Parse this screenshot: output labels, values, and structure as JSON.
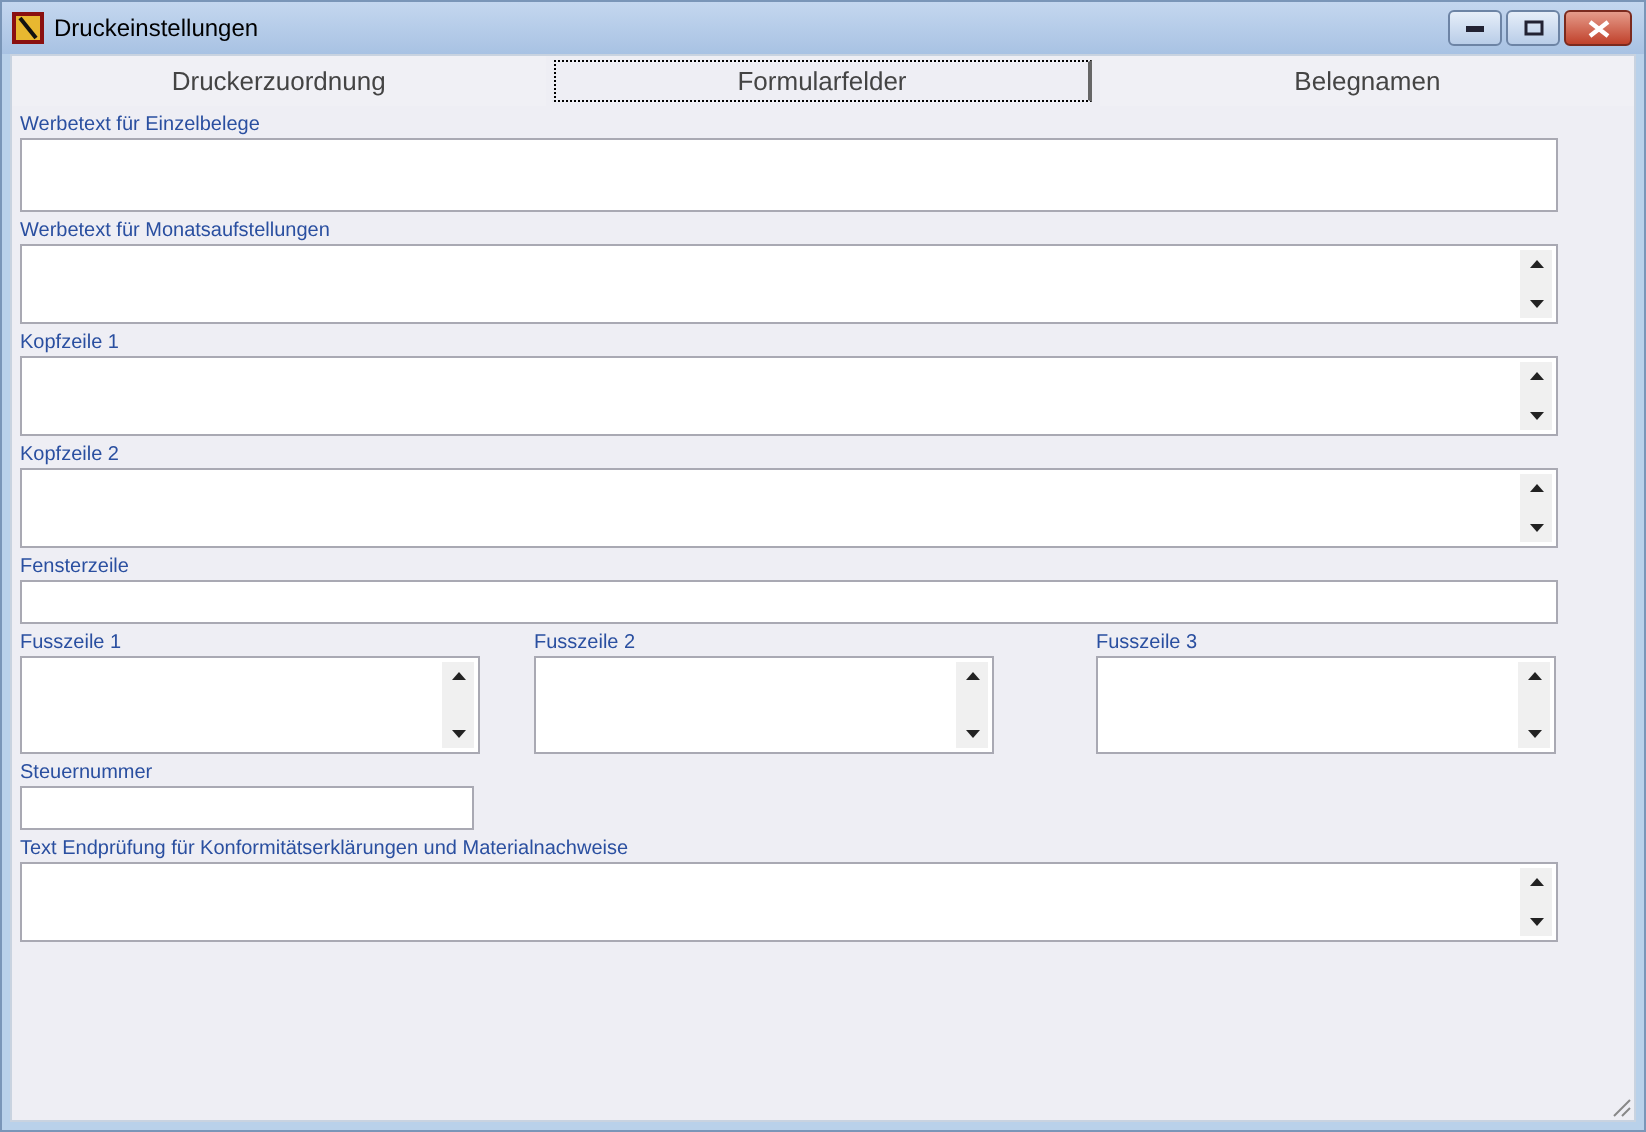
{
  "window": {
    "title": "Druckeinstellungen"
  },
  "tabs": [
    {
      "label": "Druckerzuordnung",
      "selected": false
    },
    {
      "label": "Formularfelder",
      "selected": true
    },
    {
      "label": "Belegnamen",
      "selected": false
    }
  ],
  "rows": [
    {
      "fields": [
        {
          "label": "Werbetext für Einzelbelege",
          "kind": "box"
        }
      ]
    },
    {
      "fields": [
        {
          "label": "Werbetext für Monatsaufstellungen",
          "kind": "memo"
        }
      ]
    },
    {
      "fields": [
        {
          "label": "Kopfzeile 1",
          "kind": "memo"
        }
      ]
    },
    {
      "fields": [
        {
          "label": "Kopfzeile 2",
          "kind": "memo"
        }
      ]
    },
    {
      "fields": [
        {
          "label": "Fensterzeile",
          "kind": "line"
        }
      ]
    },
    {
      "fields": [
        {
          "label": "Fusszeile 1",
          "kind": "memo"
        },
        {
          "label": "Fusszeile 2",
          "kind": "memo"
        },
        {
          "label": "Fusszeile 3",
          "kind": "memo"
        }
      ]
    },
    {
      "fields": [
        {
          "label": "Steuernummer",
          "kind": "line"
        }
      ]
    },
    {
      "fields": [
        {
          "label": "Text Endprüfung für Konformitätserklärungen und Materialnachweise",
          "kind": "memo"
        }
      ]
    }
  ]
}
